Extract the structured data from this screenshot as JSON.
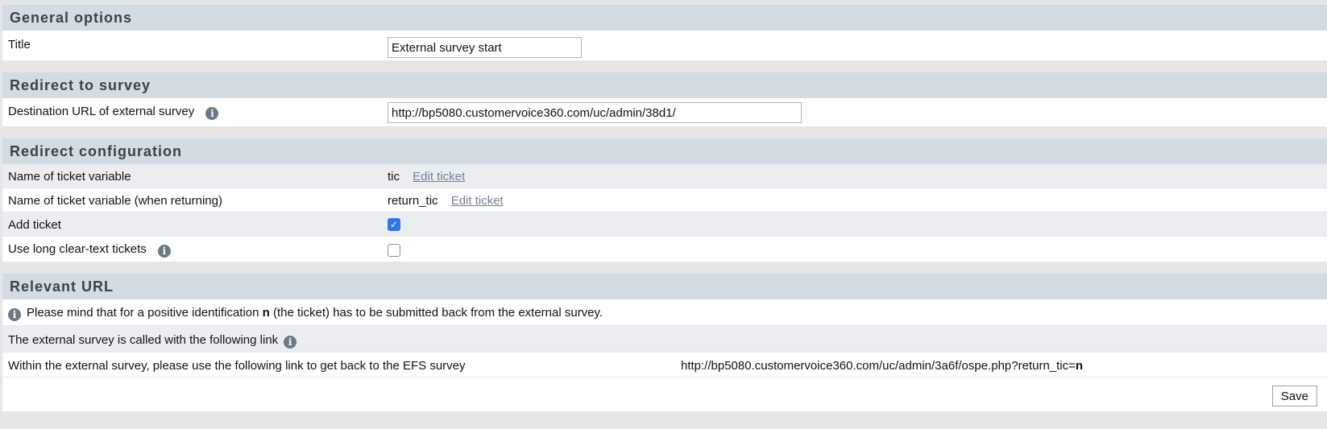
{
  "general": {
    "header": "General options",
    "title_label": "Title",
    "title_value": "External survey start"
  },
  "redirect_survey": {
    "header": "Redirect to survey",
    "dest_label": "Destination URL of external survey",
    "dest_value": "http://bp5080.customervoice360.com/uc/admin/38d1/"
  },
  "redirect_config": {
    "header": "Redirect configuration",
    "ticket_var_label": "Name of ticket variable",
    "ticket_var_value": "tic",
    "ticket_var_edit": "Edit ticket",
    "return_var_label": "Name of ticket variable (when returning)",
    "return_var_value": "return_tic",
    "return_var_edit": "Edit ticket",
    "add_ticket_label": "Add ticket",
    "add_ticket_checked": true,
    "long_tickets_label": "Use long clear-text tickets",
    "long_tickets_checked": false
  },
  "relevant_url": {
    "header": "Relevant URL",
    "note_prefix": "Please mind that for a positive identification ",
    "note_bold": "n",
    "note_suffix": " (the ticket) has to be submitted back from the external survey.",
    "called_label": "The external survey is called with the following link",
    "within_label": "Within the external survey, please use the following link to get back to the EFS survey",
    "within_url_prefix": "http://bp5080.customervoice360.com/uc/admin/3a6f/ospe.php?return_tic=",
    "within_url_bold": "n"
  },
  "footer": {
    "save_label": "Save"
  },
  "icons": {
    "info_glyph": "i",
    "check_glyph": "✓"
  }
}
